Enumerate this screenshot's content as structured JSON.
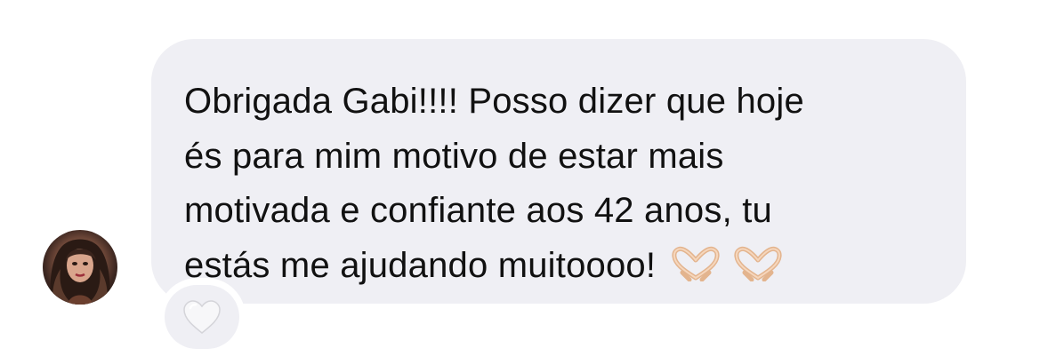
{
  "message": {
    "lines": [
      "Obrigada Gabi!!!! Posso dizer que hoje",
      "és para mim motivo de estar mais",
      "motivada e confiante aos 42 anos, tu",
      "estás me ajudando muitoooo!"
    ],
    "emoji_icons": [
      "heart-hands-icon",
      "heart-hands-icon"
    ]
  },
  "reaction": {
    "icon": "white-heart-icon"
  },
  "avatar": {
    "icon": "profile-photo"
  },
  "colors": {
    "bubble": "#efeff4",
    "text": "#111111",
    "background": "#ffffff",
    "heart": "#f4f4f6"
  }
}
